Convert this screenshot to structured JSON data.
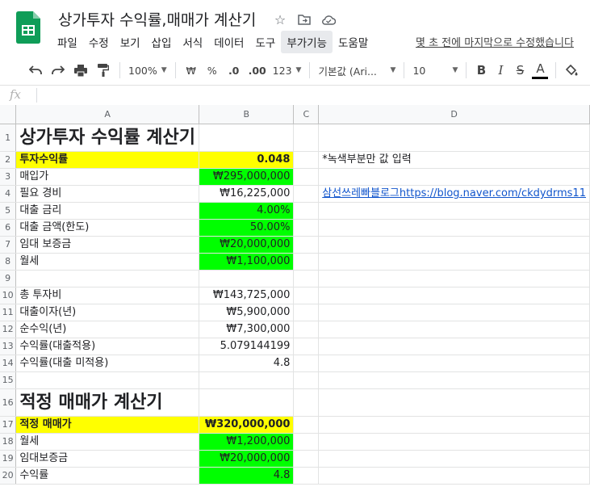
{
  "header": {
    "doc_title": "상가투자 수익률,매매가 계산기",
    "last_edit": "몇 초 전에 마지막으로 수정했습니다",
    "menu": [
      "파일",
      "수정",
      "보기",
      "삽입",
      "서식",
      "데이터",
      "도구",
      "부가기능",
      "도움말"
    ],
    "active_menu_index": 7,
    "colors": {
      "logo_green": "#0f9d58",
      "highlight_yellow": "#ffff00",
      "highlight_green": "#00ff00",
      "link": "#1155cc"
    }
  },
  "toolbar": {
    "zoom": "100%",
    "currency": "₩",
    "percent": "%",
    "dec_decrease": ".0",
    "dec_increase": ".00",
    "more_formats": "123",
    "font": "기본값 (Ari...",
    "font_size": "10",
    "bold": "B",
    "italic": "I",
    "strike": "S",
    "text_color": "A"
  },
  "formula_bar": {
    "fx_label": "fx",
    "value": ""
  },
  "grid": {
    "columns": [
      "A",
      "B",
      "C",
      "D"
    ],
    "rows": [
      {
        "n": "1",
        "a": "상가투자 수익률 계산기",
        "b": "",
        "c": "",
        "d": ""
      },
      {
        "n": "2",
        "a": "투자수익률",
        "b": "0.048",
        "c": "",
        "d": "*녹색부분만 값 입력"
      },
      {
        "n": "3",
        "a": "매입가",
        "b": "₩295,000,000",
        "c": "",
        "d": ""
      },
      {
        "n": "4",
        "a": "필요 경비",
        "b": "₩16,225,000",
        "c": "",
        "d": "삼선쓰레빠블로그https://blog.naver.com/ckdydrms11"
      },
      {
        "n": "5",
        "a": "대출 금리",
        "b": "4.00%",
        "c": "",
        "d": ""
      },
      {
        "n": "6",
        "a": "대출 금액(한도)",
        "b": "50.00%",
        "c": "",
        "d": ""
      },
      {
        "n": "7",
        "a": "임대 보증금",
        "b": "₩20,000,000",
        "c": "",
        "d": ""
      },
      {
        "n": "8",
        "a": "월세",
        "b": "₩1,100,000",
        "c": "",
        "d": ""
      },
      {
        "n": "9",
        "a": "",
        "b": "",
        "c": "",
        "d": ""
      },
      {
        "n": "10",
        "a": "총 투자비",
        "b": "₩143,725,000",
        "c": "",
        "d": ""
      },
      {
        "n": "11",
        "a": "대출이자(년)",
        "b": "₩5,900,000",
        "c": "",
        "d": ""
      },
      {
        "n": "12",
        "a": "순수익(년)",
        "b": "₩7,300,000",
        "c": "",
        "d": ""
      },
      {
        "n": "13",
        "a": "수익률(대출적용)",
        "b": "5.079144199",
        "c": "",
        "d": ""
      },
      {
        "n": "14",
        "a": "수익률(대출 미적용)",
        "b": "4.8",
        "c": "",
        "d": ""
      },
      {
        "n": "15",
        "a": "",
        "b": "",
        "c": "",
        "d": ""
      },
      {
        "n": "16",
        "a": "적정 매매가 계산기",
        "b": "",
        "c": "",
        "d": ""
      },
      {
        "n": "17",
        "a": "적정 매매가",
        "b": "₩320,000,000",
        "c": "",
        "d": ""
      },
      {
        "n": "18",
        "a": "월세",
        "b": "₩1,200,000",
        "c": "",
        "d": ""
      },
      {
        "n": "19",
        "a": "임대보증금",
        "b": "₩20,000,000",
        "c": "",
        "d": ""
      },
      {
        "n": "20",
        "a": "수익률",
        "b": "4.8",
        "c": "",
        "d": ""
      }
    ]
  }
}
